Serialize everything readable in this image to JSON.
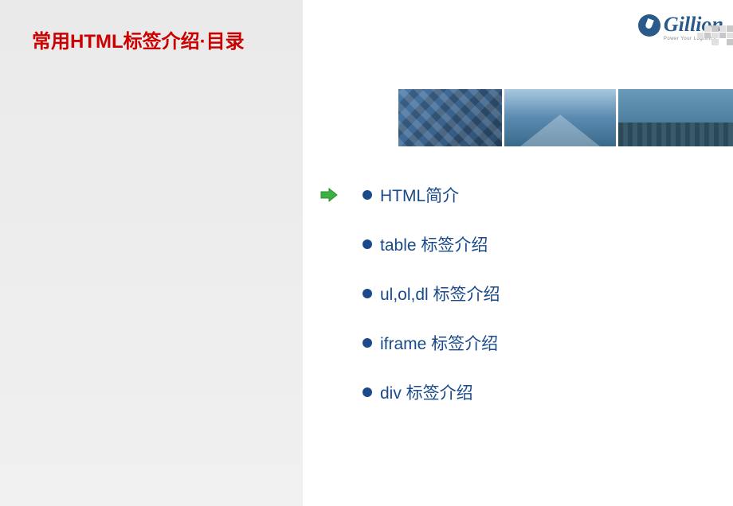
{
  "slide": {
    "title": "常用HTML标签介绍·目录"
  },
  "logo": {
    "name": "Gillion",
    "tagline": "Power Your Logistics"
  },
  "toc": {
    "items": [
      {
        "label": "HTML简介",
        "current": true
      },
      {
        "label": "table 标签介绍",
        "current": false
      },
      {
        "label": "ul,ol,dl 标签介绍",
        "current": false
      },
      {
        "label": "iframe 标签介绍",
        "current": false
      },
      {
        "label": "div 标签介绍",
        "current": false
      }
    ]
  }
}
